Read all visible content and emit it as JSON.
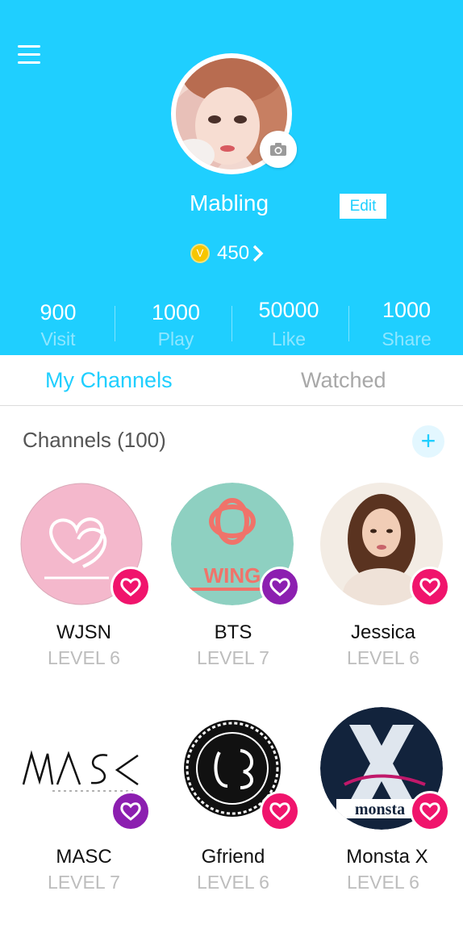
{
  "profile": {
    "name": "Mabling",
    "edit_label": "Edit",
    "coins": "450"
  },
  "stats": [
    {
      "value": "900",
      "label": "Visit"
    },
    {
      "value": "1000",
      "label": "Play"
    },
    {
      "value": "50000",
      "label": "Like"
    },
    {
      "value": "1000",
      "label": "Share"
    }
  ],
  "tabs": {
    "my_channels": "My Channels",
    "watched": "Watched"
  },
  "channels_header": "Channels (100)",
  "channels": [
    {
      "name": "WJSN",
      "level": "LEVEL 6"
    },
    {
      "name": "BTS",
      "level": "LEVEL 7"
    },
    {
      "name": "Jessica",
      "level": "LEVEL 6"
    },
    {
      "name": "MASC",
      "level": "LEVEL 7"
    },
    {
      "name": "Gfriend",
      "level": "LEVEL 6"
    },
    {
      "name": "Monsta X",
      "level": "LEVEL 6"
    }
  ],
  "colors": {
    "accent": "#1fcfff",
    "badge_pink": "#f0146c",
    "badge_purple": "#8c1fb0"
  }
}
